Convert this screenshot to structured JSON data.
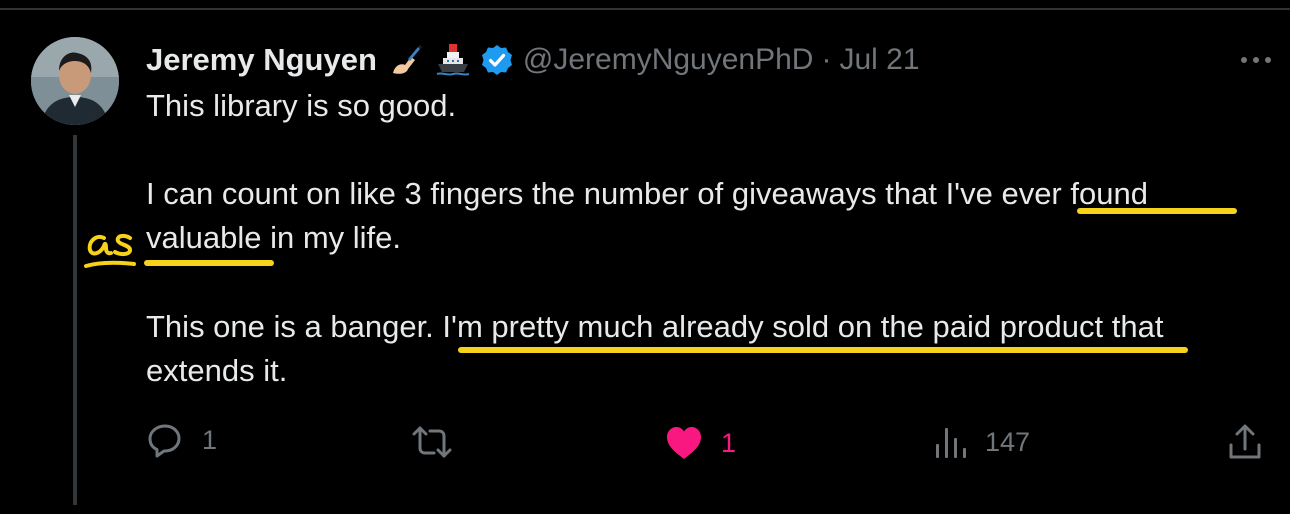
{
  "tweet": {
    "author": {
      "name": "Jeremy Nguyen",
      "name_emojis": [
        "writing-hand-icon",
        "ship-icon"
      ],
      "verified": true,
      "handle": "@JeremyNguyenPhD",
      "separator": "·",
      "date": "Jul 21"
    },
    "paragraphs": [
      [
        "This library is so good."
      ],
      [
        "I can count on like 3 fingers the number of giveaways that I've ever found",
        "valuable in my life."
      ],
      [
        "This one is a banger. I'm pretty much already sold on the paid product that",
        "extends it."
      ]
    ],
    "annotations": {
      "handwritten_text": "as",
      "highlight_color": "#f7d21b",
      "underlined_phrases": [
        "ever found",
        "valuable",
        "I'm pretty much already sold on the paid product"
      ]
    },
    "actions": {
      "reply": {
        "icon": "reply-icon",
        "count": "1"
      },
      "retweet": {
        "icon": "retweet-icon",
        "count": ""
      },
      "like": {
        "icon": "heart-icon",
        "count": "1",
        "liked": true,
        "color": "#f91880"
      },
      "views": {
        "icon": "views-icon",
        "count": "147"
      },
      "share": {
        "icon": "share-icon"
      }
    },
    "more_icon": "more-options-icon"
  }
}
